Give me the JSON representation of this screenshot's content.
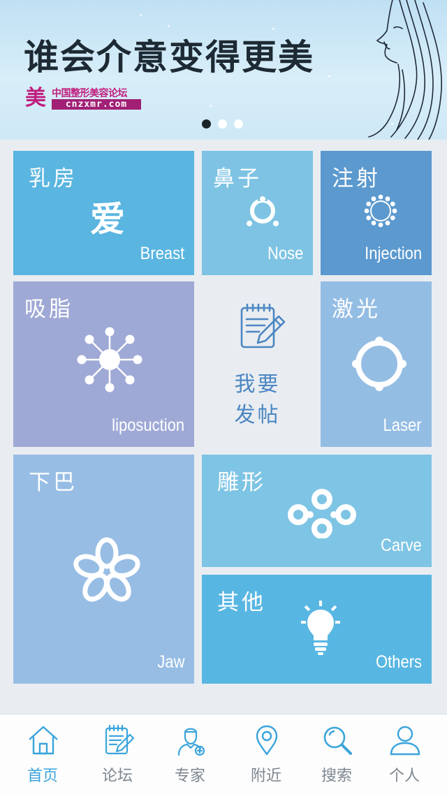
{
  "banner": {
    "title": "谁会介意变得更美",
    "logo_cn": "中国整形美容论坛",
    "logo_en": "cnzxmr.com",
    "logo_mark": "美",
    "carousel_total": 3,
    "carousel_active": 1
  },
  "tiles": {
    "breast": {
      "cn": "乳房",
      "en": "Breast",
      "glyph": "爱",
      "color": "#5ab5e0",
      "icon": "love-glyph-icon"
    },
    "nose": {
      "cn": "鼻子",
      "en": "Nose",
      "color": "#7ec3e3",
      "icon": "nose-icon"
    },
    "injection": {
      "cn": "注射",
      "en": "Injection",
      "color": "#5b99cf",
      "icon": "injection-ring-icon"
    },
    "liposuction": {
      "cn": "吸脂",
      "en": "liposuction",
      "color": "#9fa9d6",
      "icon": "liposuction-icon"
    },
    "laser": {
      "cn": "激光",
      "en": "Laser",
      "color": "#94bde4",
      "icon": "laser-target-icon"
    },
    "jaw": {
      "cn": "下巴",
      "en": "Jaw",
      "color": "#97bde4",
      "icon": "flower-knot-icon"
    },
    "carve": {
      "cn": "雕形",
      "en": "Carve",
      "color": "#7ec4e4",
      "icon": "carve-knot-icon"
    },
    "others": {
      "cn": "其他",
      "en": "Others",
      "color": "#58b6e2",
      "icon": "lightbulb-icon"
    }
  },
  "post": {
    "line1": "我要",
    "line2": "发帖",
    "icon": "edit-note-icon"
  },
  "nav": [
    {
      "label": "首页",
      "icon": "home-icon",
      "active": true
    },
    {
      "label": "论坛",
      "icon": "forum-note-icon",
      "active": false
    },
    {
      "label": "专家",
      "icon": "expert-icon",
      "active": false
    },
    {
      "label": "附近",
      "icon": "location-icon",
      "active": false
    },
    {
      "label": "搜索",
      "icon": "search-icon",
      "active": false
    },
    {
      "label": "个人",
      "icon": "user-icon",
      "active": false
    }
  ],
  "colors": {
    "accent": "#3aa4dc",
    "nav_inactive": "#7d8790",
    "post_text": "#4c86c2"
  }
}
